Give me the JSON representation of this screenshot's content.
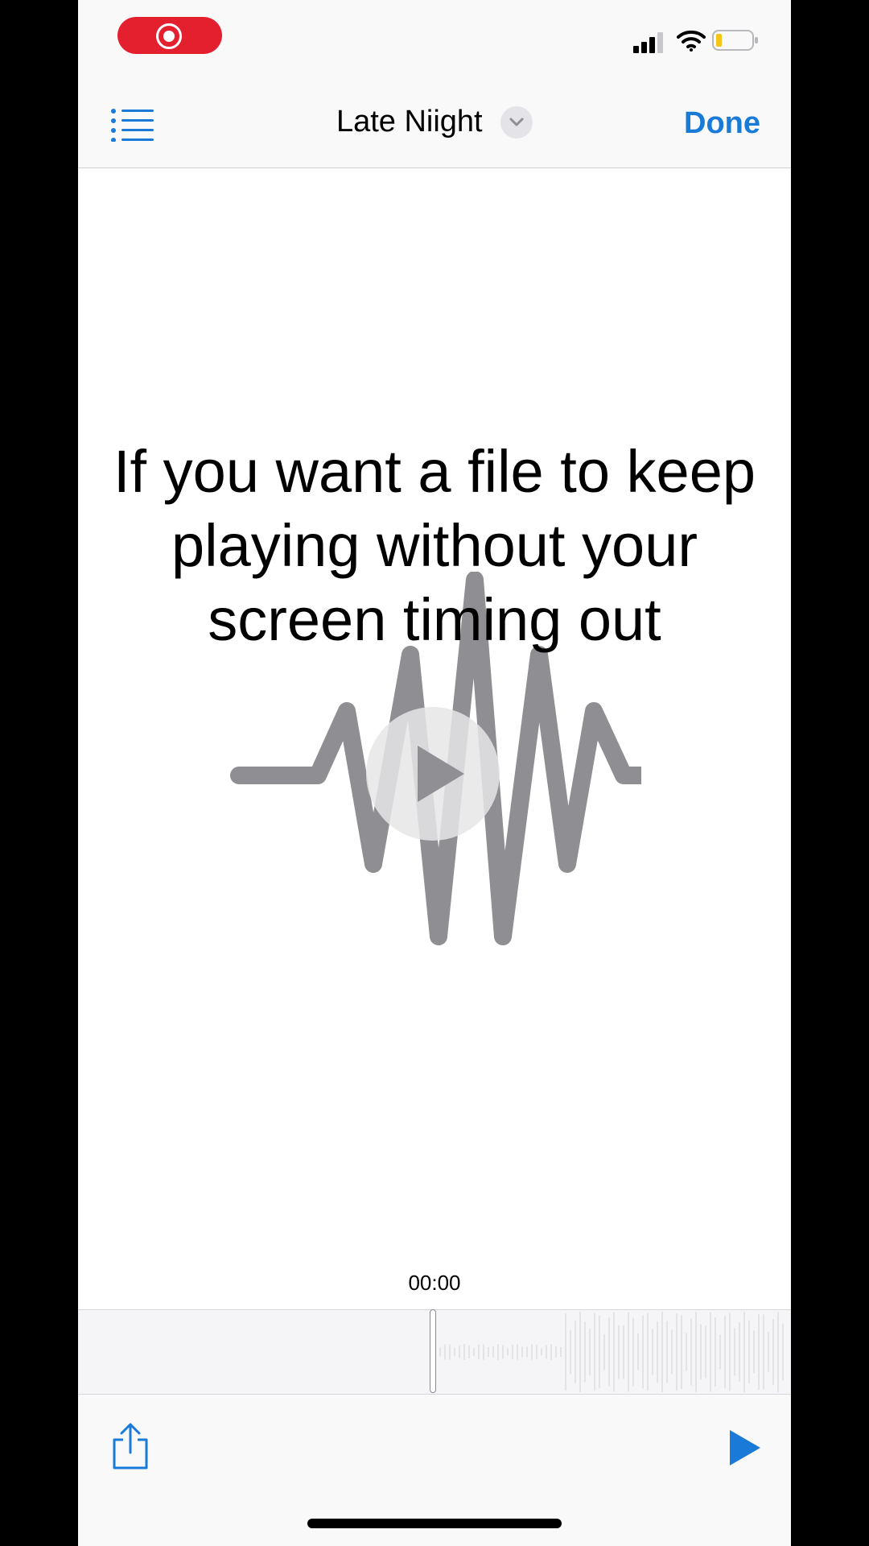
{
  "status_bar": {
    "recording_indicator": "record-icon",
    "icons": [
      "signal-icon",
      "wifi-icon",
      "battery-icon"
    ]
  },
  "nav": {
    "list_icon": "list-icon",
    "title": "Late Niight",
    "title_menu_icon": "chevron-down-icon",
    "done_label": "Done"
  },
  "caption": {
    "lines": [
      "If you want a file to keep",
      "playing without your",
      "screen timing out"
    ]
  },
  "player": {
    "artwork_icon": "waveform-icon",
    "overlay_icon": "play-icon",
    "timecode": "00:00",
    "progress_fraction": 0.0
  },
  "toolbar": {
    "share_icon": "share-icon",
    "play_icon": "play-icon"
  },
  "colors": {
    "accent": "#1a7ad8",
    "record": "#e5202e",
    "waveform": "#8e8e93",
    "background": "#ffffff",
    "bar_background": "#f9f9fa"
  }
}
